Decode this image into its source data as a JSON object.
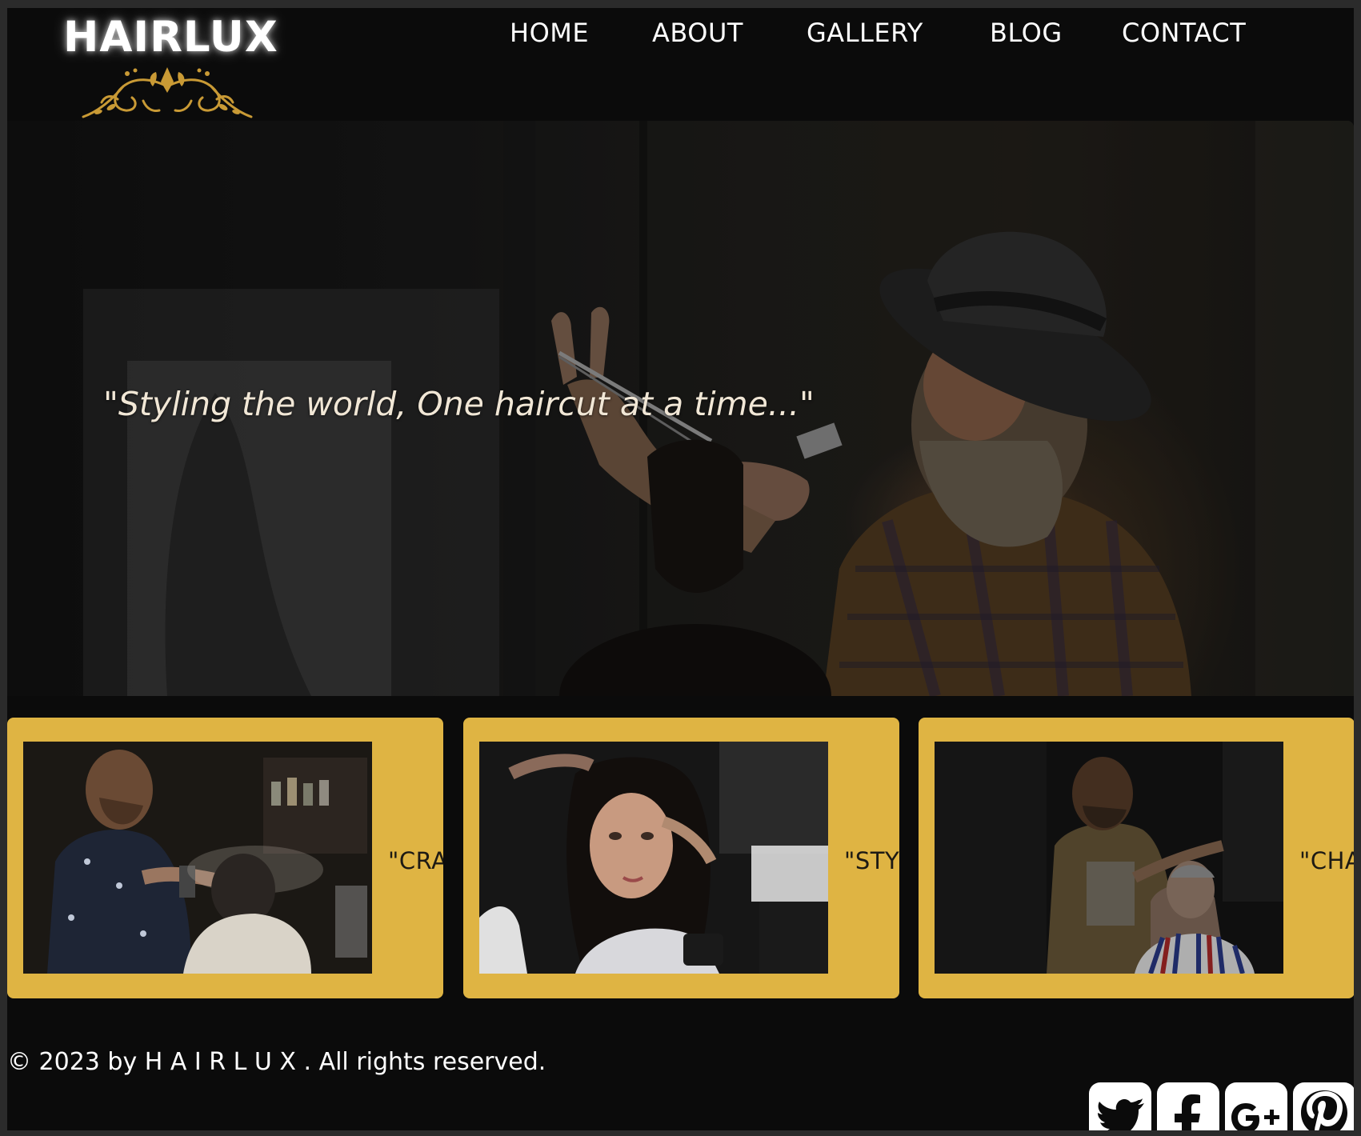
{
  "brand": {
    "name": "HAIRLUX",
    "accent": "#dfb443",
    "logo_gold": "#c99a35"
  },
  "nav": {
    "items": [
      {
        "label": "HOME"
      },
      {
        "label": "ABOUT"
      },
      {
        "label": "GALLERY"
      },
      {
        "label": "BLOG"
      },
      {
        "label": "CONTACT"
      }
    ]
  },
  "hero": {
    "quote": "\"Styling the world, One haircut at a time...\""
  },
  "cards": [
    {
      "caption": "\"CRAF"
    },
    {
      "caption": "\"STYL"
    },
    {
      "caption": "\"CHA"
    }
  ],
  "footer": {
    "copyright": "© 2023 by H A I R L U X . All rights reserved.",
    "social": [
      {
        "icon": "twitter-icon"
      },
      {
        "icon": "facebook-icon"
      },
      {
        "icon": "google-plus-icon"
      },
      {
        "icon": "pinterest-icon"
      }
    ]
  }
}
